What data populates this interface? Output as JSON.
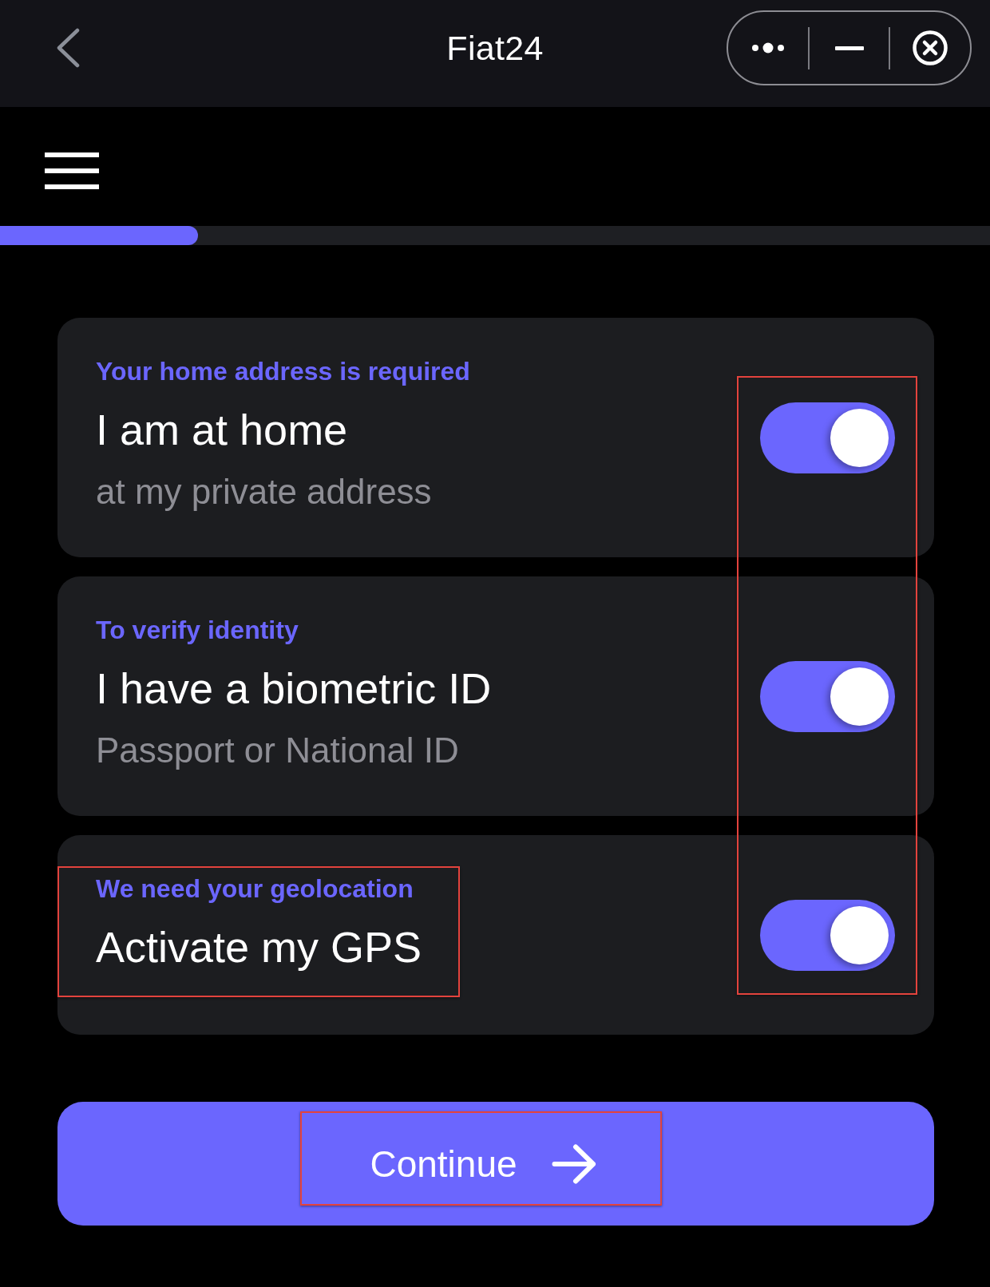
{
  "window": {
    "title": "Fiat24"
  },
  "progress": {
    "level": 0.2
  },
  "options": [
    {
      "caption": "Your home address is required",
      "title": "I am at home",
      "description": "at my private address",
      "on": true
    },
    {
      "caption": "To verify identity",
      "title": "I have a biometric ID",
      "description": "Passport or National ID",
      "on": true
    },
    {
      "caption": "We need your geolocation",
      "title": "Activate my GPS",
      "on": true
    }
  ],
  "continue_button": {
    "label": "Continue"
  }
}
